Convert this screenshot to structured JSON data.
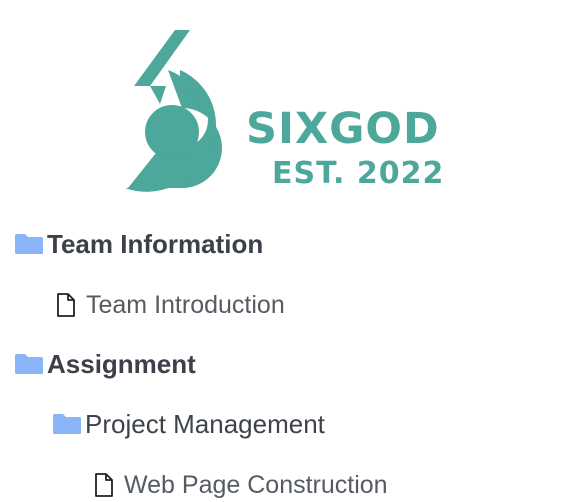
{
  "logo": {
    "line1": "SIXGOD",
    "line2": "EST. 2022",
    "color": "#4da79b"
  },
  "tree": {
    "items": [
      {
        "label": "Team Information",
        "icon": "folder-icon",
        "level": 0
      },
      {
        "label": "Team Introduction",
        "icon": "file-icon",
        "level": 1
      },
      {
        "label": "Assignment",
        "icon": "folder-icon",
        "level": 0
      },
      {
        "label": "Project Management",
        "icon": "folder-icon",
        "level": 1
      },
      {
        "label": "Web Page Construction",
        "icon": "file-icon",
        "level": 2
      }
    ]
  },
  "colors": {
    "folder": "#8ab4f8",
    "text": "#3c4049"
  }
}
